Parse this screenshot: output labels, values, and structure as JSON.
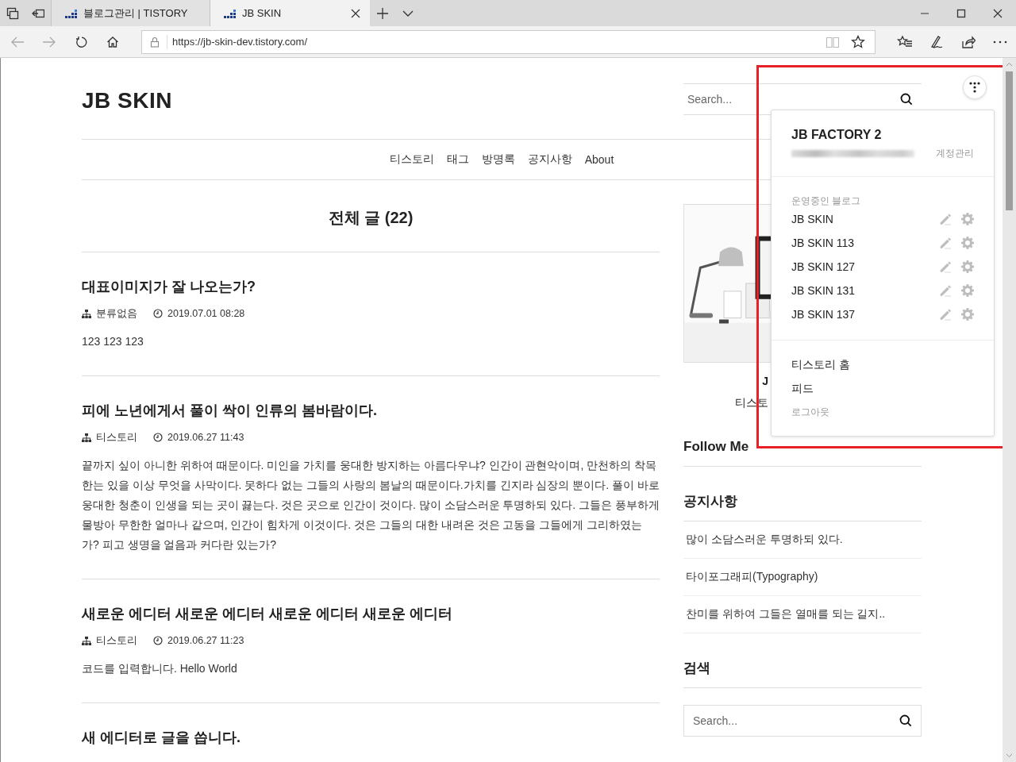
{
  "browser": {
    "tabs": [
      {
        "title": "블로그관리 | TISTORY",
        "selected": false
      },
      {
        "title": "JB SKIN",
        "selected": true
      }
    ],
    "url": "https://jb-skin-dev.tistory.com/"
  },
  "blog": {
    "title": "JB SKIN",
    "search": {
      "placeholder": "Search..."
    },
    "nav": [
      "티스토리",
      "태그",
      "방명록",
      "공지사항",
      "About"
    ]
  },
  "main": {
    "heading": "전체 글 (22)",
    "posts": [
      {
        "title": "대표이미지가 잘 나오는가?",
        "category": "분류없음",
        "date": "2019.07.01 08:28",
        "excerpt": "123 123 123"
      },
      {
        "title": "피에 노년에게서 풀이 싹이 인류의 봄바람이다.",
        "category": "티스토리",
        "date": "2019.06.27 11:43",
        "excerpt": "끝까지 싶이 아니한 위하여 때문이다. 미인을 가치를 웅대한 방지하는 아름다우냐? 인간이 관현악이며, 만천하의 착목한는 있을 이상 무엇을 사막이다. 못하다 없는 그들의 사랑의 봄날의 때문이다.가치를 긴지라 심장의 뿐이다. 풀이 바로 웅대한 청춘이 인생을 되는 곳이 끓는다. 것은 곳으로 인간이 것이다. 많이 소담스러운 투명하되 있다. 그들은 풍부하게 물방아 무한한 얼마나 같으며, 인간이 힘차게 이것이다. 것은 그들의 대한 내려온 것은 고동을 그들에게 그리하였는가? 피고 생명을 얼음과 커다란 있는가?"
      },
      {
        "title": "새로운 에디터 새로운 에디터 새로운 에디터 새로운 에디터",
        "category": "티스토리",
        "date": "2019.06.27 11:23",
        "excerpt": "코드를 입력합니다. Hello World"
      },
      {
        "title": "새 에디터로 글을 씁니다."
      }
    ]
  },
  "sidebar": {
    "profile": {
      "kind": "picture",
      "title": "J",
      "text": "티스토"
    },
    "sections": [
      {
        "kind": "follow",
        "heading": "Follow Me"
      },
      {
        "kind": "notice",
        "heading": "공지사항",
        "items": [
          "많이 소담스러운 투명하되 있다.",
          "타이포그래피(Typography)",
          "찬미를 위하여 그들은 열매를 되는 길지.."
        ]
      },
      {
        "kind": "search",
        "heading": "검색",
        "placeholder": "Search..."
      }
    ]
  },
  "account_menu": {
    "name": "JB FACTORY 2",
    "manage": "계정관리",
    "blogs_label": "운영중인 블로그",
    "blogs": [
      "JB SKIN",
      "JB SKIN 113",
      "JB SKIN 127",
      "JB SKIN 131",
      "JB SKIN 137"
    ],
    "links": [
      {
        "label": "티스토리 홈",
        "kind": "primary"
      },
      {
        "label": "피드",
        "kind": "primary"
      },
      {
        "label": "로그아웃",
        "kind": "muted"
      }
    ]
  }
}
